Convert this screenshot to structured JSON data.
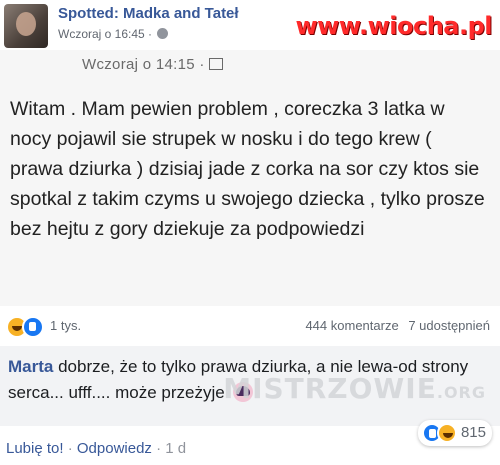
{
  "header": {
    "page_name": "Spotted: Madka and Tateł",
    "timestamp": "Wczoraj o 16:45 ·",
    "watermark": "www.wiocha.pl"
  },
  "screenshot": {
    "timestamp": "Wczoraj o 14:15 ·",
    "post_text": "Witam . Mam pewien problem , coreczka 3 latka w nocy pojawil sie strupek w nosku i do tego krew ( prawa dziurka ) dzisiaj jade z corka na sor czy ktos sie spotkal z takim czyms u swojego dziecka , tylko prosze bez hejtu z gory dziekuje za podpowiedzi"
  },
  "reactions": {
    "count": "1 tys.",
    "comments": "444 komentarze",
    "shares": "7 udostępnień"
  },
  "comment": {
    "author": "Marta",
    "text": "dobrze, że to tylko prawa dziurka, a nie lewa-od strony serca... ufff.... może przeżyje",
    "watermark": "MISTRZOWIE",
    "watermark_suffix": ".ORG",
    "like_label": "Lubię to!",
    "separator": "·",
    "reply_label": "Odpowiedz",
    "time": "· 1 d",
    "reaction_count": "815"
  },
  "colors": {
    "link": "#385898",
    "watermark_red": "#ff2a2a",
    "like_blue": "#1877f2",
    "haha_yellow": "#f7b125"
  }
}
